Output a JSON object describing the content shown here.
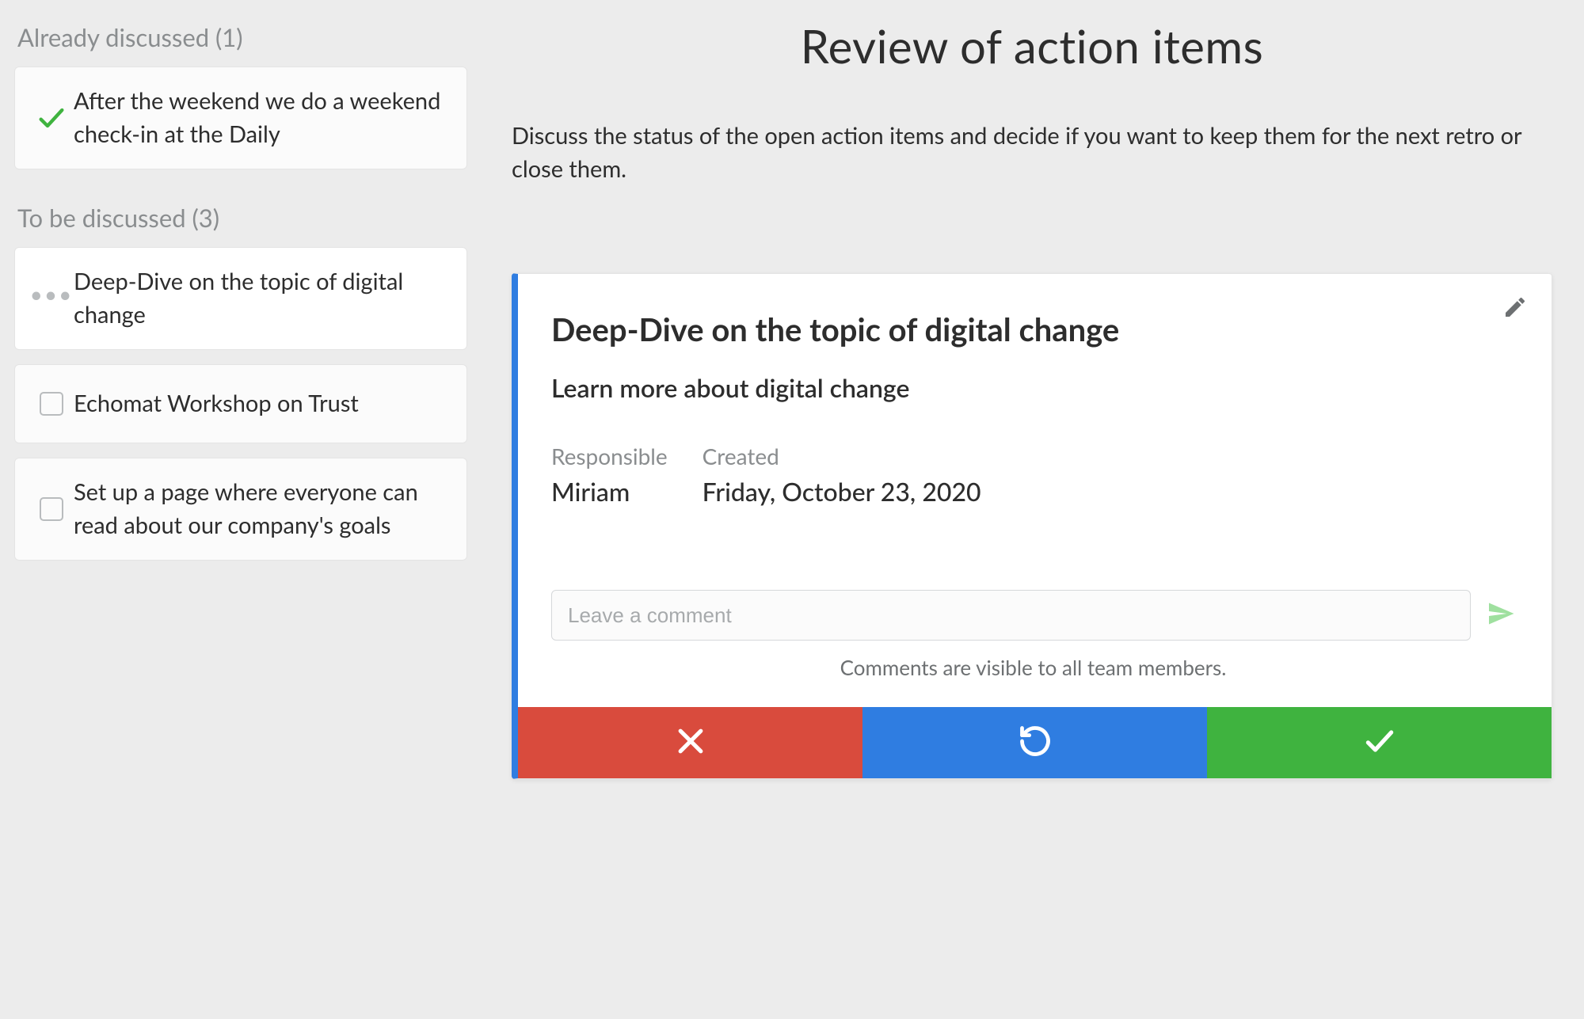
{
  "sidebar": {
    "discussed_header": "Already discussed (1)",
    "discussed_items": [
      {
        "text": "After the weekend we do a weekend check-in at the Daily",
        "status_icon": "checkmark-green"
      }
    ],
    "to_discuss_header": "To be discussed (3)",
    "to_discuss_items": [
      {
        "text": "Deep-Dive on the topic of digital change",
        "status_icon": "dots",
        "selected": true
      },
      {
        "text": "Echomat Workshop on Trust",
        "status_icon": "checkbox-empty",
        "selected": false
      },
      {
        "text": "Set up a page where everyone can read about our company's goals",
        "status_icon": "checkbox-empty",
        "selected": false
      }
    ]
  },
  "main": {
    "title": "Review of action items",
    "description": "Discuss the status of the open action items and decide if you want to keep them for the next retro or close them."
  },
  "detail": {
    "title": "Deep-Dive on the topic of digital change",
    "subtitle": "Learn more about digital change",
    "meta": {
      "responsible_label": "Responsible",
      "responsible_value": "Miriam",
      "created_label": "Created",
      "created_value": "Friday, October 23, 2020"
    },
    "comment_placeholder": "Leave a comment",
    "comment_note": "Comments are visible to all team members."
  },
  "colors": {
    "accent_blue": "#2f7de1",
    "danger_red": "#d94b3d",
    "success_green": "#3fb33f"
  }
}
